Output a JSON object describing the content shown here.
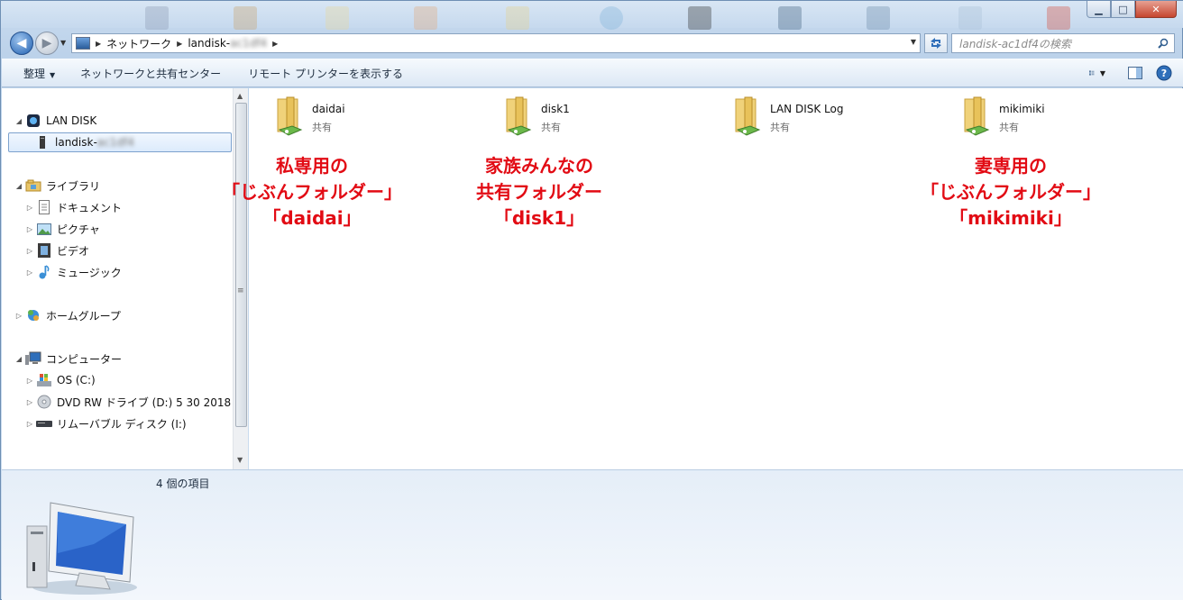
{
  "window": {
    "controls": {
      "minimize": "▁",
      "maximize": "□",
      "close": "✕"
    }
  },
  "address": {
    "crumbs": [
      "ネットワーク",
      "landisk-ac1df4"
    ],
    "refresh_icon": "refresh-icon"
  },
  "search": {
    "placeholder": "landisk-ac1df4の検索"
  },
  "toolbar": {
    "organize": "整理",
    "network_center": "ネットワークと共有センター",
    "remote_printers": "リモート プリンターを表示する"
  },
  "nav": {
    "lan_disk": "LAN DISK",
    "landisk_prefix": "landisk-",
    "landisk_suffix": "ac1df4",
    "libraries": "ライブラリ",
    "documents": "ドキュメント",
    "pictures": "ピクチャ",
    "videos": "ビデオ",
    "music": "ミュージック",
    "homegroup": "ホームグループ",
    "computer": "コンピューター",
    "drive_c": "OS (C:)",
    "drive_d": "DVD RW ドライブ (D:) 5 30 2018",
    "drive_i": "リムーバブル ディスク (I:)"
  },
  "items": [
    {
      "name": "daidai",
      "type": "共有"
    },
    {
      "name": "disk1",
      "type": "共有"
    },
    {
      "name": "LAN DISK Log",
      "type": "共有"
    },
    {
      "name": "mikimiki",
      "type": "共有"
    }
  ],
  "annotations": {
    "daidai": [
      "私専用の",
      "「じぶんフォルダー」",
      "「daidai」"
    ],
    "disk1": [
      "家族みんなの",
      "共有フォルダー",
      "「disk1」"
    ],
    "mikimiki": [
      "妻専用の",
      "「じぶんフォルダー」",
      "「mikimiki」"
    ]
  },
  "status": {
    "count": "4 個の項目"
  },
  "colors": {
    "accent": "#2f6fba",
    "annotation": "#e20b14",
    "selection": "#dcebfc"
  }
}
